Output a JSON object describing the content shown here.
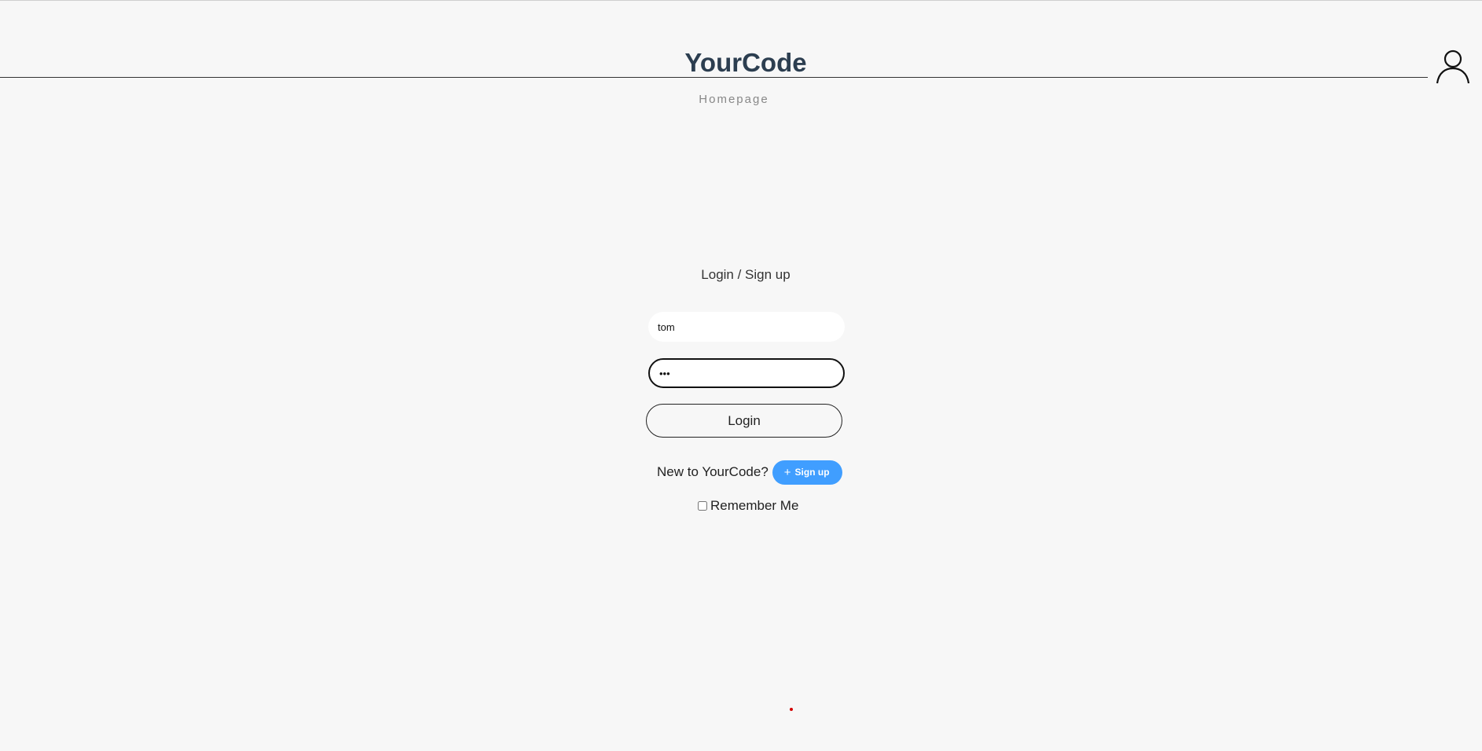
{
  "header": {
    "brand": "YourCode",
    "nav_link": "Homepage",
    "user_icon": "user-icon"
  },
  "login_form": {
    "title": "Login / Sign up",
    "username_value": "tom",
    "password_value": "•••",
    "login_label": "Login",
    "signup_prompt": "New to YourCode?",
    "signup_label": "Sign up",
    "signup_icon": "plus-icon",
    "remember_label": "Remember Me",
    "remember_checked": false
  },
  "colors": {
    "background": "#f7f7f7",
    "brand": "#2c3e50",
    "signup_button": "#409eff",
    "status_dot": "#d40000"
  }
}
